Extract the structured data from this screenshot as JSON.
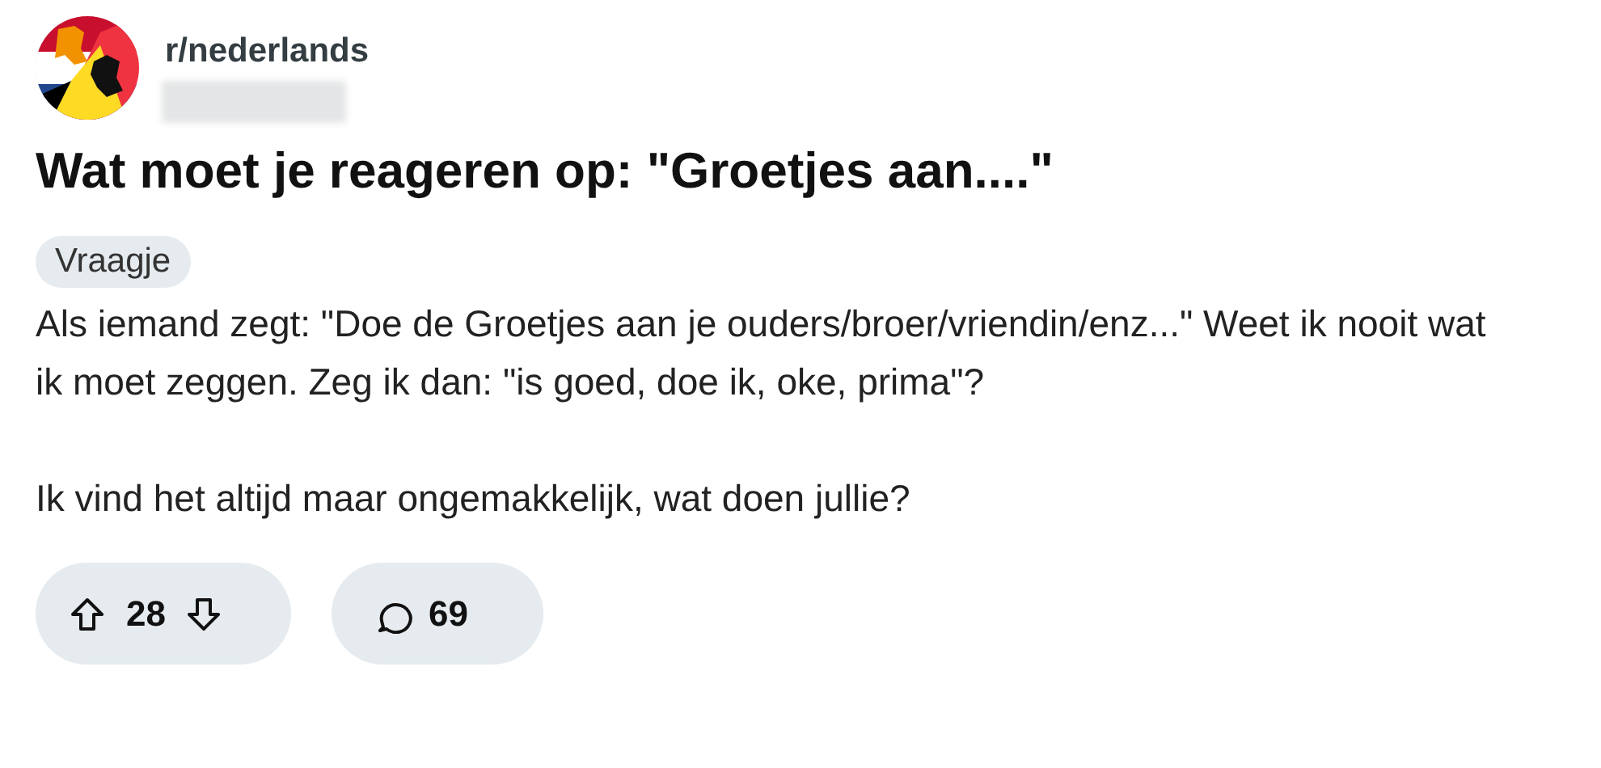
{
  "post": {
    "subreddit": "r/nederlands",
    "title": "Wat moet je reageren op: \"Groetjes aan....\"",
    "flair": "Vraagje",
    "paragraphs": [
      "Als iemand zegt: \"Doe de Groetjes aan je ouders/broer/vriendin/enz...\" Weet ik nooit wat ik moet zeggen. Zeg ik dan: \"is goed, doe ik, oke, prima\"?",
      "Ik vind het altijd maar ongemakkelijk, wat doen jullie?"
    ],
    "votes": "28",
    "comments": "69"
  }
}
